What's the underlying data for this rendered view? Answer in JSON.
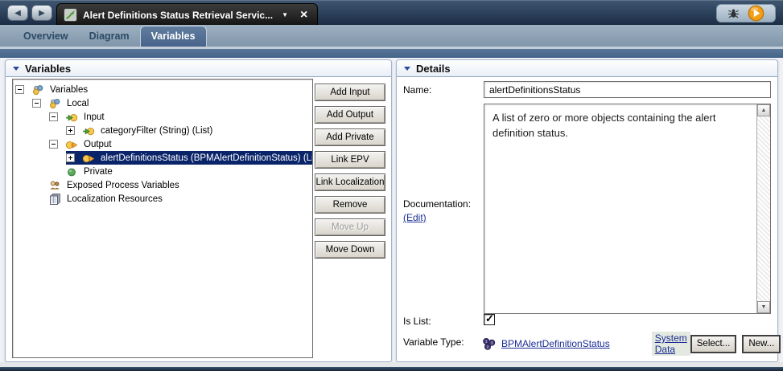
{
  "window": {
    "nav_back_glyph": "◀",
    "nav_forward_glyph": "▶",
    "doc_tab": {
      "title": "Alert Definitions Status Retrieval Servic...",
      "dropdown_glyph": "▼",
      "close_glyph": "×"
    }
  },
  "tabs": [
    {
      "label": "Overview",
      "active": false
    },
    {
      "label": "Diagram",
      "active": false
    },
    {
      "label": "Variables",
      "active": true
    }
  ],
  "variables_panel": {
    "title": "Variables",
    "tree": [
      {
        "label": "Variables",
        "level": 0,
        "expander": "minus",
        "icon": "variables-icon",
        "selected": false
      },
      {
        "label": "Local",
        "level": 1,
        "expander": "minus",
        "icon": "variables-icon",
        "selected": false
      },
      {
        "label": "Input",
        "level": 2,
        "expander": "minus",
        "icon": "input-icon",
        "selected": false
      },
      {
        "label": "categoryFilter (String) (List)",
        "level": 3,
        "expander": "plus",
        "icon": "input-icon",
        "selected": false
      },
      {
        "label": "Output",
        "level": 2,
        "expander": "minus",
        "icon": "output-icon",
        "selected": false
      },
      {
        "label": "alertDefinitionsStatus (BPMAlertDefinitionStatus) (List)",
        "level": 3,
        "expander": "plus",
        "icon": "output-icon",
        "selected": true
      },
      {
        "label": "Private",
        "level": 2,
        "expander": "none",
        "icon": "private-icon",
        "selected": false
      },
      {
        "label": "Exposed Process Variables",
        "level": 1,
        "expander": "none",
        "icon": "epv-icon",
        "selected": false
      },
      {
        "label": "Localization Resources",
        "level": 1,
        "expander": "none",
        "icon": "localization-icon",
        "selected": false
      }
    ],
    "buttons": [
      {
        "label": "Add Input",
        "disabled": false
      },
      {
        "label": "Add Output",
        "disabled": false
      },
      {
        "label": "Add Private",
        "disabled": false
      },
      {
        "label": "Link EPV",
        "disabled": false
      },
      {
        "label": "Link Localization",
        "disabled": false
      },
      {
        "label": "Remove",
        "disabled": false
      },
      {
        "label": "Move Up",
        "disabled": true
      },
      {
        "label": "Move Down",
        "disabled": false
      }
    ]
  },
  "details_panel": {
    "title": "Details",
    "name_label": "Name:",
    "name_value": "alertDefinitionsStatus",
    "documentation_label": "Documentation:",
    "edit_link": "(Edit)",
    "documentation_text": "A list of zero or more objects containing the alert definition status.",
    "scroll_up_glyph": "▲",
    "scroll_down_glyph": "▼",
    "is_list_label": "Is List:",
    "is_list_checked": true,
    "check_glyph": "✓",
    "variable_type_label": "Variable Type:",
    "variable_type_link": "BPMAlertDefinitionStatus",
    "system_data_link": "System Data",
    "select_button": "Select...",
    "new_button": "New..."
  },
  "colors": {
    "selection_highlight": "#0a246a",
    "link": "#1b2d94",
    "run_accent": "#f29e17",
    "active_tab": "#48648a",
    "topbar": "#1c2e46"
  }
}
